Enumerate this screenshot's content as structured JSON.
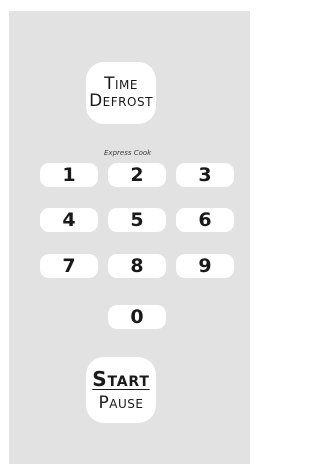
{
  "keypad": {
    "time_defrost": {
      "line1": "Time",
      "line2": "Defrost"
    },
    "express_cook_label": "Express Cook",
    "digits": {
      "k1": "1",
      "k2": "2",
      "k3": "3",
      "k4": "4",
      "k5": "5",
      "k6": "6",
      "k7": "7",
      "k8": "8",
      "k9": "9",
      "k0": "0"
    },
    "start_pause": {
      "line1": "Start",
      "line2": "Pause"
    }
  },
  "colors": {
    "panel": "#e2e2e2",
    "key": "#ffffff",
    "text": "#1a1a1a"
  }
}
